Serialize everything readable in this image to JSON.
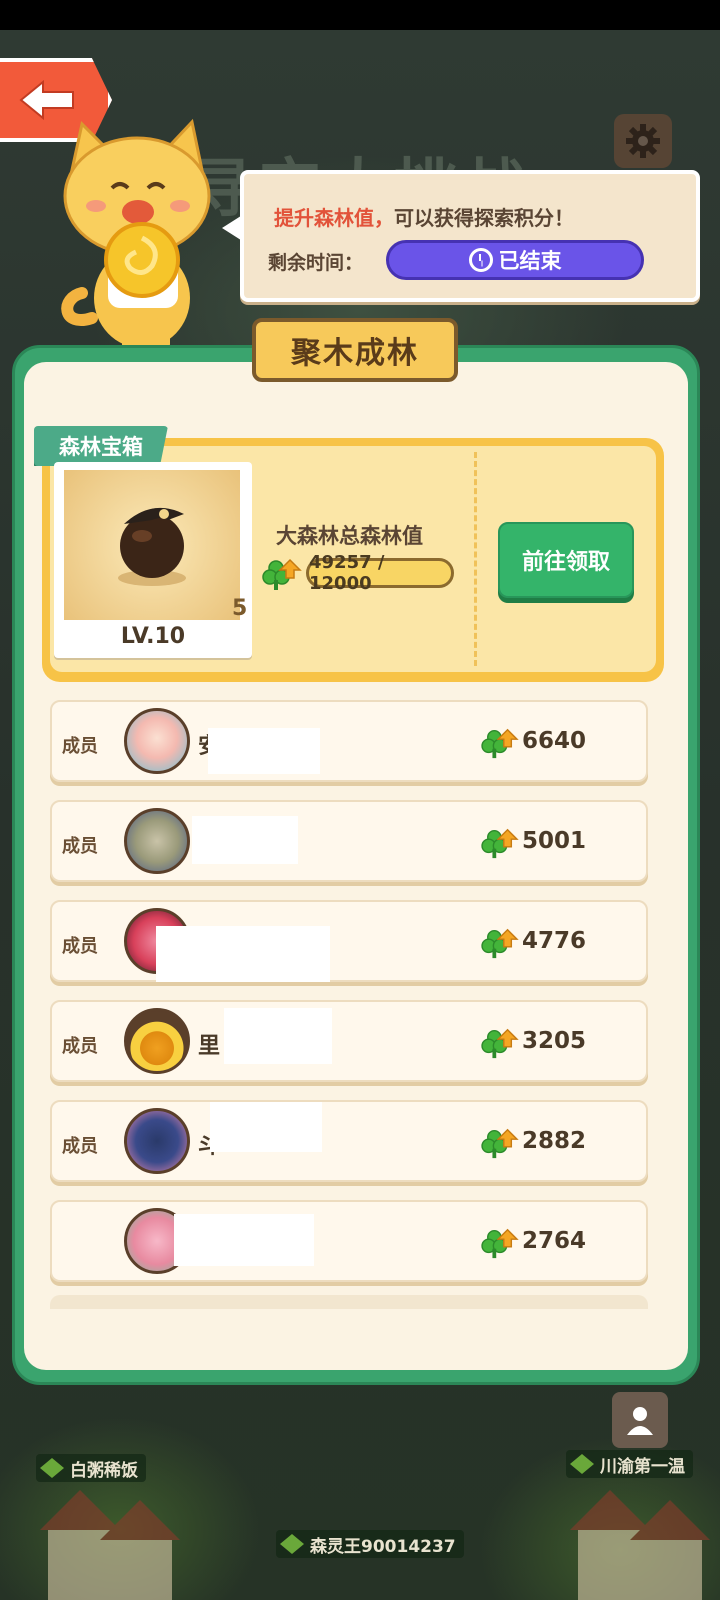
{
  "header": {
    "title": "寻宝大挑战",
    "back_icon": "arrow-left-icon",
    "settings_icon": "gear-icon"
  },
  "bubble": {
    "highlight": "提升森林值，",
    "message": "可以获得探索积分！",
    "time_label": "剩余时间：",
    "timer_status": "已结束"
  },
  "panel": {
    "title": "聚木成林"
  },
  "chest": {
    "tag": "森林宝箱",
    "count": "5",
    "level": "LV.10",
    "forest_label": "大森林总森林值",
    "progress_text": "49257 / 12000",
    "claim_button": "前往领取"
  },
  "members": [
    {
      "label": "成员",
      "name": "安",
      "score": "6640"
    },
    {
      "label": "成员",
      "name": "",
      "score": "5001"
    },
    {
      "label": "成员",
      "name": "",
      "score": "4776"
    },
    {
      "label": "成员",
      "name": "里",
      "score": "3205"
    },
    {
      "label": "成员",
      "name": "斗",
      "score": "2882"
    },
    {
      "label": "",
      "name": "",
      "score": "2764"
    }
  ],
  "footer": {
    "left_player": "白粥稀饭",
    "right_player": "川渝第一温",
    "center_player": "森灵王90014237"
  },
  "colors": {
    "panel_green": "#3aa46e",
    "accent_red": "#e2533a",
    "timer_purple": "#6a54e8",
    "claim_green": "#34b46a"
  }
}
